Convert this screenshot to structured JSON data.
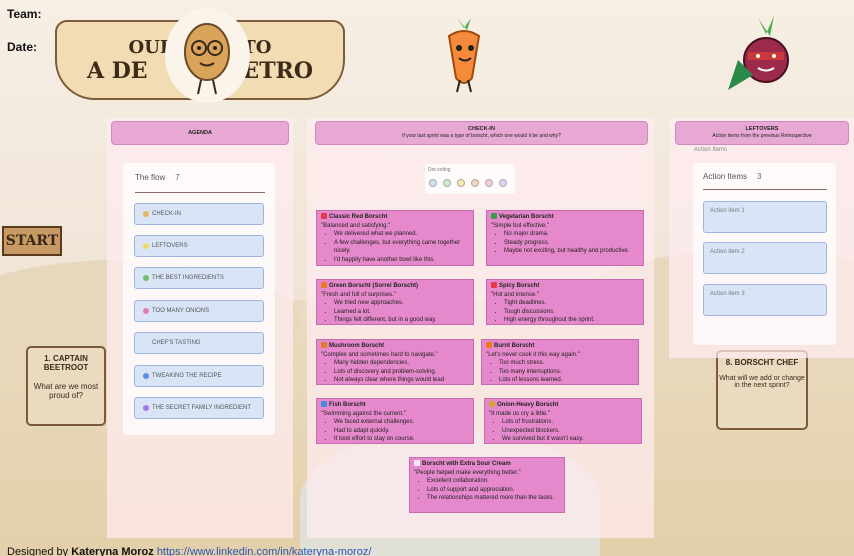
{
  "page": {
    "team_label": "Team:",
    "date_label": "Date:",
    "banner_line1": "OUP           TO",
    "banner_line2": "A DE          RETRO",
    "start_sign": "START",
    "footer_prefix": "Designed by ",
    "footer_author": "Kateryna Moroz",
    "footer_link": "https://www.linkedin.com/in/kateryna-moroz/"
  },
  "background_signs": [
    {
      "title": "1. CAPTAIN BEETROOT",
      "question": "What are we most proud of?"
    },
    {
      "title": "8. BORSCHT CHEF",
      "question": "What will we add or change in the next sprint?"
    }
  ],
  "agenda": {
    "header_title": "AGENDA",
    "flow_title": "The flow",
    "flow_count": "7",
    "items": [
      {
        "label": "CHECK-IN",
        "color": "#e7b55a"
      },
      {
        "label": "LEFTOVERS",
        "color": "#f2d76a"
      },
      {
        "label": "THE BEST INGREDIENTS",
        "color": "#6fc06a"
      },
      {
        "label": "TOO MANY ONIONS",
        "color": "#e57ab6"
      },
      {
        "label": "CHEF'S TASTING",
        "color": ""
      },
      {
        "label": "TWEAKING THE RECIPE",
        "color": "#5b8fe0"
      },
      {
        "label": "THE SECRET FAMILY INGREDIENT",
        "color": "#a27ae0"
      }
    ]
  },
  "checkin": {
    "header_title": "CHECK-IN",
    "header_subtitle": "If your last sprint was a type of borscht, which one would it be and why?",
    "dot_voting_label": "Dot voting",
    "dot_colors": [
      "#cfe2f7",
      "#cfeccf",
      "#fbe7a7",
      "#f8d1b8",
      "#f7c8e3",
      "#e0d0f7"
    ],
    "cards": [
      {
        "icon_color": "#e5394a",
        "title": "Classic Red Borscht",
        "quote": "\"Balanced and satisfying.\"",
        "bullets": [
          "We delivered what we planned.",
          "A few challenges, but everything came together nicely.",
          "I'd happily have another bowl like this."
        ]
      },
      {
        "icon_color": "#3a9b4a",
        "title": "Vegetarian Borscht",
        "quote": "\"Simple but effective.\"",
        "bullets": [
          "No major drama.",
          "Steady progress.",
          "Maybe not exciting, but healthy and productive."
        ]
      },
      {
        "icon_color": "#e57a2a",
        "title": "Green Borscht (Sorrel Borscht)",
        "quote": "\"Fresh and full of surprises.\"",
        "bullets": [
          "We tried new approaches.",
          "Learned a lot.",
          "Things felt different, but in a good way."
        ]
      },
      {
        "icon_color": "#e5394a",
        "title": "Spicy Borscht",
        "quote": "\"Hot and intense.\"",
        "bullets": [
          "Tight deadlines.",
          "Tough discussions.",
          "High energy throughout the sprint."
        ]
      },
      {
        "icon_color": "#e57a2a",
        "title": "Mushroom Borscht",
        "quote": "\"Complex and sometimes hard to navigate.\"",
        "bullets": [
          "Many hidden dependencies.",
          "Lots of discovery and problem-solving.",
          "Not always clear where things would lead"
        ]
      },
      {
        "icon_color": "#f07a1a",
        "title": "Burnt Borscht",
        "quote": "\"Let's never cook it this way again.\"",
        "bullets": [
          "Too much stress.",
          "Too many interruptions.",
          "Lots of lessons learned."
        ]
      },
      {
        "icon_color": "#4a8ad9",
        "title": "Fish Borscht",
        "quote": "\"Swimming against the current.\"",
        "bullets": [
          "We faced external challenges.",
          "Had to adapt quickly.",
          "It took effort to stay on course."
        ]
      },
      {
        "icon_color": "#d9a13a",
        "title": "Onion-Heavy Borscht",
        "quote": "\"It made us cry a little.\"",
        "bullets": [
          "Lots of frustrations.",
          "Unexpected blockers.",
          "We survived but it wasn't easy."
        ]
      },
      {
        "icon_color": "#f0e8f0",
        "title": "Borscht with Extra Sour Cream",
        "quote": "\"People helped make everything better.\"",
        "bullets": [
          "Excellent collaboration.",
          "Lots of support and appreciation.",
          "The relationships mattered more than the tasks."
        ]
      }
    ]
  },
  "leftovers": {
    "header_title": "LEFTOVERS",
    "header_subtitle": "Action items from the previous Retrospective",
    "action_items_top_label": "Action Items",
    "list_title": "Action Items",
    "list_count": "3",
    "items": [
      "Action item 1",
      "Action item 2",
      "Action item 3"
    ]
  }
}
